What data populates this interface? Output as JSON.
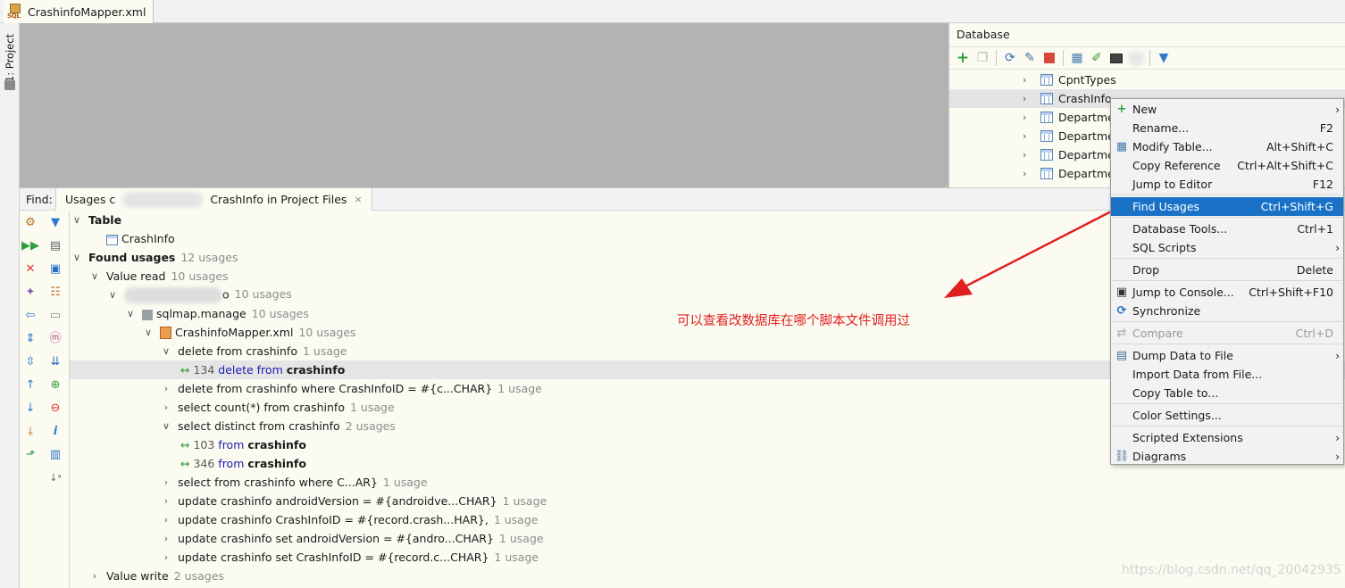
{
  "editor_tab": {
    "filename": "CrashinfoMapper.xml",
    "icon": "sql-file-icon"
  },
  "left_strip": {
    "project_label": "1: Project"
  },
  "database": {
    "title": "Database",
    "toolbar_icons": [
      "add-icon",
      "copy-icon",
      "refresh-icon",
      "properties-icon",
      "stop-icon",
      "table-icon",
      "edit-icon",
      "console-icon",
      "filter-icon"
    ],
    "rows": [
      {
        "name": "CpntTypes",
        "selected": false
      },
      {
        "name": "CrashInfo",
        "selected": true
      },
      {
        "name": "Departme",
        "selected": false
      },
      {
        "name": "Departme",
        "selected": false
      },
      {
        "name": "Departme",
        "selected": false
      },
      {
        "name": "Departme",
        "selected": false
      }
    ]
  },
  "find": {
    "label": "Find:",
    "tab_prefix": "Usages c",
    "tab_suffix": "CrashInfo in Project Files",
    "tab_close": "×"
  },
  "tree": [
    {
      "arrow": "∨",
      "text": "Table",
      "count": "",
      "bold": true
    },
    {
      "arrow": "",
      "text": "CrashInfo",
      "count": "",
      "icon": "table-icon"
    },
    {
      "arrow": "∨",
      "text": "Found usages",
      "count": "12 usages",
      "bold": true
    },
    {
      "arrow": "∨",
      "text": "Value read",
      "count": "10 usages"
    },
    {
      "arrow": "∨",
      "text": "o",
      "count": "10 usages",
      "blurred": true
    },
    {
      "arrow": "∨",
      "text": "sqlmap.manage",
      "count": "10 usages",
      "icon": "package-icon"
    },
    {
      "arrow": "∨",
      "text": "CrashinfoMapper.xml",
      "count": "10 usages",
      "icon": "xml-file-icon"
    },
    {
      "arrow": "∨",
      "text": "delete from crashinfo",
      "count": "1 usage"
    },
    {
      "line": "134",
      "kw": "delete from",
      "obj": "crashinfo",
      "highlighted": true
    },
    {
      "arrow": "›",
      "text": "delete from crashinfo where CrashInfoID = #{c...CHAR}",
      "count": "1 usage"
    },
    {
      "arrow": "›",
      "text": "select count(*) from crashinfo",
      "count": "1 usage"
    },
    {
      "arrow": "∨",
      "text": "select distinct from crashinfo",
      "count": "2 usages"
    },
    {
      "line": "103",
      "kw": "from",
      "obj": "crashinfo"
    },
    {
      "line": "346",
      "kw": "from",
      "obj": "crashinfo"
    },
    {
      "arrow": "›",
      "text": "select from crashinfo where C...AR}",
      "count": "1 usage"
    },
    {
      "arrow": "›",
      "text": "update crashinfo androidVersion = #{androidve...CHAR}",
      "count": "1 usage"
    },
    {
      "arrow": "›",
      "text": "update crashinfo CrashInfoID = #{record.crash...HAR},",
      "count": "1 usage"
    },
    {
      "arrow": "›",
      "text": "update crashinfo set androidVersion = #{andro...CHAR}",
      "count": "1 usage"
    },
    {
      "arrow": "›",
      "text": "update crashinfo set CrashInfoID = #{record.c...CHAR}",
      "count": "1 usage"
    },
    {
      "arrow": "›",
      "text": "Value write",
      "count": "2 usages"
    }
  ],
  "menu": [
    {
      "label": "New",
      "shortcut": "",
      "submenu": true,
      "icon": "plus-icon"
    },
    {
      "label": "Rename...",
      "shortcut": "F2"
    },
    {
      "label": "Modify Table...",
      "shortcut": "Alt+Shift+C",
      "icon": "table-icon"
    },
    {
      "label": "Copy Reference",
      "shortcut": "Ctrl+Alt+Shift+C"
    },
    {
      "label": "Jump to Editor",
      "shortcut": "F12"
    },
    {
      "sep": true
    },
    {
      "label": "Find Usages",
      "shortcut": "Ctrl+Shift+G",
      "selected": true
    },
    {
      "sep": true
    },
    {
      "label": "Database Tools...",
      "shortcut": "Ctrl+1"
    },
    {
      "label": "SQL Scripts",
      "shortcut": "",
      "submenu": true
    },
    {
      "sep": true
    },
    {
      "label": "Drop",
      "shortcut": "Delete"
    },
    {
      "sep": true
    },
    {
      "label": "Jump to Console...",
      "shortcut": "Ctrl+Shift+F10",
      "icon": "console-icon"
    },
    {
      "label": "Synchronize",
      "shortcut": "",
      "icon": "sync-icon"
    },
    {
      "sep": true
    },
    {
      "label": "Compare",
      "shortcut": "Ctrl+D",
      "disabled": true,
      "icon": "compare-icon"
    },
    {
      "sep": true
    },
    {
      "label": "Dump Data to File",
      "shortcut": "",
      "submenu": true,
      "icon": "dump-icon"
    },
    {
      "label": "Import Data from File...",
      "shortcut": ""
    },
    {
      "label": "Copy Table to...",
      "shortcut": ""
    },
    {
      "sep": true
    },
    {
      "label": "Color Settings...",
      "shortcut": ""
    },
    {
      "sep": true
    },
    {
      "label": "Scripted Extensions",
      "shortcut": "",
      "submenu": true
    },
    {
      "label": "Diagrams",
      "shortcut": "",
      "submenu": true,
      "icon": "diagram-icon"
    }
  ],
  "annotation": "可以查看改数据库在哪个脚本文件调用过",
  "watermark": "https://blog.csdn.net/qq_20042935",
  "colors": {
    "selection": "#1a72c7",
    "annotation": "#e02020",
    "editor_bg": "#b3b3b3",
    "panel_bg": "#fbfbf2"
  }
}
